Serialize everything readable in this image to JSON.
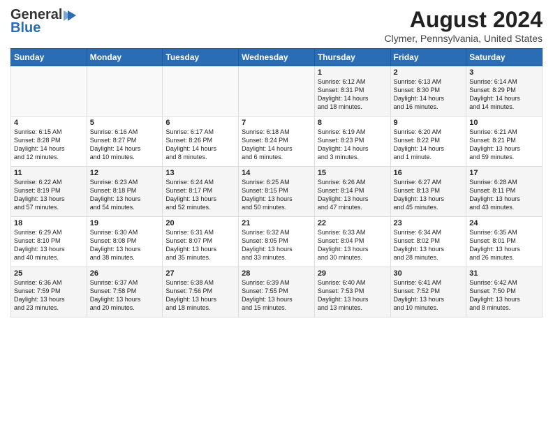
{
  "logo": {
    "line1": "General",
    "line2": "Blue"
  },
  "title": "August 2024",
  "subtitle": "Clymer, Pennsylvania, United States",
  "headers": [
    "Sunday",
    "Monday",
    "Tuesday",
    "Wednesday",
    "Thursday",
    "Friday",
    "Saturday"
  ],
  "weeks": [
    {
      "row_bg": "odd",
      "days": [
        {
          "num": "",
          "content": ""
        },
        {
          "num": "",
          "content": ""
        },
        {
          "num": "",
          "content": ""
        },
        {
          "num": "",
          "content": ""
        },
        {
          "num": "1",
          "content": "Sunrise: 6:12 AM\nSunset: 8:31 PM\nDaylight: 14 hours\nand 18 minutes."
        },
        {
          "num": "2",
          "content": "Sunrise: 6:13 AM\nSunset: 8:30 PM\nDaylight: 14 hours\nand 16 minutes."
        },
        {
          "num": "3",
          "content": "Sunrise: 6:14 AM\nSunset: 8:29 PM\nDaylight: 14 hours\nand 14 minutes."
        }
      ]
    },
    {
      "row_bg": "even",
      "days": [
        {
          "num": "4",
          "content": "Sunrise: 6:15 AM\nSunset: 8:28 PM\nDaylight: 14 hours\nand 12 minutes."
        },
        {
          "num": "5",
          "content": "Sunrise: 6:16 AM\nSunset: 8:27 PM\nDaylight: 14 hours\nand 10 minutes."
        },
        {
          "num": "6",
          "content": "Sunrise: 6:17 AM\nSunset: 8:26 PM\nDaylight: 14 hours\nand 8 minutes."
        },
        {
          "num": "7",
          "content": "Sunrise: 6:18 AM\nSunset: 8:24 PM\nDaylight: 14 hours\nand 6 minutes."
        },
        {
          "num": "8",
          "content": "Sunrise: 6:19 AM\nSunset: 8:23 PM\nDaylight: 14 hours\nand 3 minutes."
        },
        {
          "num": "9",
          "content": "Sunrise: 6:20 AM\nSunset: 8:22 PM\nDaylight: 14 hours\nand 1 minute."
        },
        {
          "num": "10",
          "content": "Sunrise: 6:21 AM\nSunset: 8:21 PM\nDaylight: 13 hours\nand 59 minutes."
        }
      ]
    },
    {
      "row_bg": "odd",
      "days": [
        {
          "num": "11",
          "content": "Sunrise: 6:22 AM\nSunset: 8:19 PM\nDaylight: 13 hours\nand 57 minutes."
        },
        {
          "num": "12",
          "content": "Sunrise: 6:23 AM\nSunset: 8:18 PM\nDaylight: 13 hours\nand 54 minutes."
        },
        {
          "num": "13",
          "content": "Sunrise: 6:24 AM\nSunset: 8:17 PM\nDaylight: 13 hours\nand 52 minutes."
        },
        {
          "num": "14",
          "content": "Sunrise: 6:25 AM\nSunset: 8:15 PM\nDaylight: 13 hours\nand 50 minutes."
        },
        {
          "num": "15",
          "content": "Sunrise: 6:26 AM\nSunset: 8:14 PM\nDaylight: 13 hours\nand 47 minutes."
        },
        {
          "num": "16",
          "content": "Sunrise: 6:27 AM\nSunset: 8:13 PM\nDaylight: 13 hours\nand 45 minutes."
        },
        {
          "num": "17",
          "content": "Sunrise: 6:28 AM\nSunset: 8:11 PM\nDaylight: 13 hours\nand 43 minutes."
        }
      ]
    },
    {
      "row_bg": "even",
      "days": [
        {
          "num": "18",
          "content": "Sunrise: 6:29 AM\nSunset: 8:10 PM\nDaylight: 13 hours\nand 40 minutes."
        },
        {
          "num": "19",
          "content": "Sunrise: 6:30 AM\nSunset: 8:08 PM\nDaylight: 13 hours\nand 38 minutes."
        },
        {
          "num": "20",
          "content": "Sunrise: 6:31 AM\nSunset: 8:07 PM\nDaylight: 13 hours\nand 35 minutes."
        },
        {
          "num": "21",
          "content": "Sunrise: 6:32 AM\nSunset: 8:05 PM\nDaylight: 13 hours\nand 33 minutes."
        },
        {
          "num": "22",
          "content": "Sunrise: 6:33 AM\nSunset: 8:04 PM\nDaylight: 13 hours\nand 30 minutes."
        },
        {
          "num": "23",
          "content": "Sunrise: 6:34 AM\nSunset: 8:02 PM\nDaylight: 13 hours\nand 28 minutes."
        },
        {
          "num": "24",
          "content": "Sunrise: 6:35 AM\nSunset: 8:01 PM\nDaylight: 13 hours\nand 26 minutes."
        }
      ]
    },
    {
      "row_bg": "odd",
      "days": [
        {
          "num": "25",
          "content": "Sunrise: 6:36 AM\nSunset: 7:59 PM\nDaylight: 13 hours\nand 23 minutes."
        },
        {
          "num": "26",
          "content": "Sunrise: 6:37 AM\nSunset: 7:58 PM\nDaylight: 13 hours\nand 20 minutes."
        },
        {
          "num": "27",
          "content": "Sunrise: 6:38 AM\nSunset: 7:56 PM\nDaylight: 13 hours\nand 18 minutes."
        },
        {
          "num": "28",
          "content": "Sunrise: 6:39 AM\nSunset: 7:55 PM\nDaylight: 13 hours\nand 15 minutes."
        },
        {
          "num": "29",
          "content": "Sunrise: 6:40 AM\nSunset: 7:53 PM\nDaylight: 13 hours\nand 13 minutes."
        },
        {
          "num": "30",
          "content": "Sunrise: 6:41 AM\nSunset: 7:52 PM\nDaylight: 13 hours\nand 10 minutes."
        },
        {
          "num": "31",
          "content": "Sunrise: 6:42 AM\nSunset: 7:50 PM\nDaylight: 13 hours\nand 8 minutes."
        }
      ]
    }
  ]
}
